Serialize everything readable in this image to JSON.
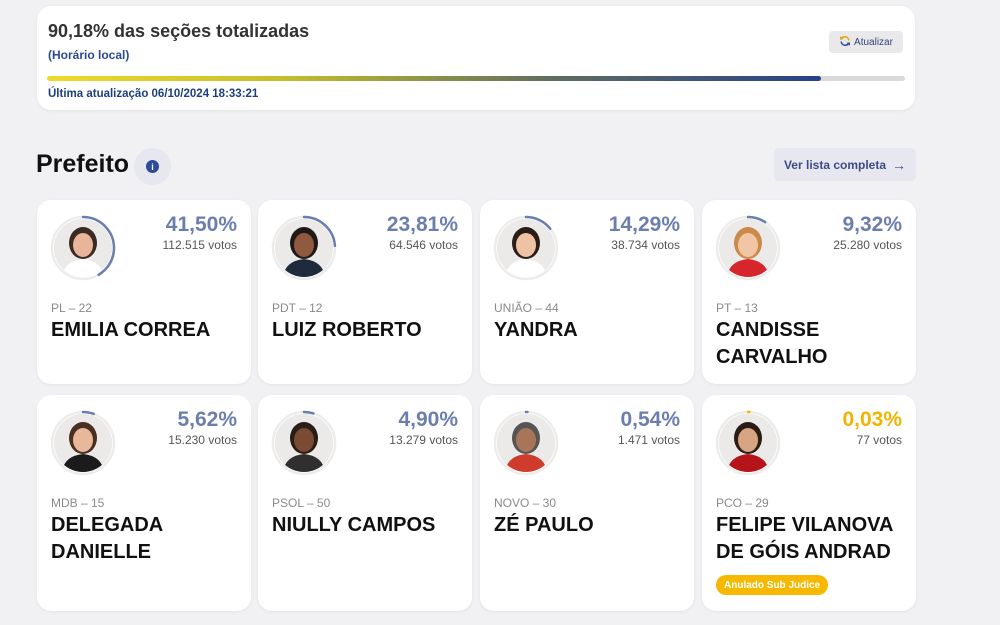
{
  "status": {
    "title": "90,18% das seções totalizadas",
    "subtitle": "(Horário local)",
    "refresh_label": "Atualizar",
    "progress_fraction": 0.9018,
    "updated": "Última atualização 06/10/2024 18:33:21"
  },
  "section": {
    "title": "Prefeito",
    "info_icon": "i",
    "list_button": "Ver lista completa",
    "list_arrow": "→"
  },
  "candidates": [
    {
      "pct": "41,50%",
      "votes": "112.515 votos",
      "party": "PL – 22",
      "name": "EMILIA CORREA",
      "share": 0.415,
      "ring_color": "#6b7eae"
    },
    {
      "pct": "23,81%",
      "votes": "64.546 votos",
      "party": "PDT – 12",
      "name": "LUIZ ROBERTO",
      "share": 0.2381,
      "ring_color": "#6b7eae"
    },
    {
      "pct": "14,29%",
      "votes": "38.734 votos",
      "party": "UNIÃO – 44",
      "name": "YANDRA",
      "share": 0.1429,
      "ring_color": "#6b7eae"
    },
    {
      "pct": "9,32%",
      "votes": "25.280 votos",
      "party": "PT – 13",
      "name": "CANDISSE CARVALHO",
      "share": 0.0932,
      "ring_color": "#6b7eae"
    },
    {
      "pct": "5,62%",
      "votes": "15.230 votos",
      "party": "MDB – 15",
      "name": "DELEGADA DANIELLE",
      "share": 0.0562,
      "ring_color": "#6b7eae"
    },
    {
      "pct": "4,90%",
      "votes": "13.279 votos",
      "party": "PSOL – 50",
      "name": "NIULLY CAMPOS",
      "share": 0.049,
      "ring_color": "#6b7eae"
    },
    {
      "pct": "0,54%",
      "votes": "1.471 votos",
      "party": "NOVO – 30",
      "name": "ZÉ PAULO",
      "share": 0.0054,
      "ring_color": "#6b7eae"
    },
    {
      "pct": "0,03%",
      "votes": "77 votos",
      "party": "PCO – 29",
      "name": "FELIPE VILANOVA DE GÓIS ANDRAD",
      "share": 0.0003,
      "ring_color": "#f1b400",
      "badge": "Anulado Sub Judice"
    }
  ]
}
